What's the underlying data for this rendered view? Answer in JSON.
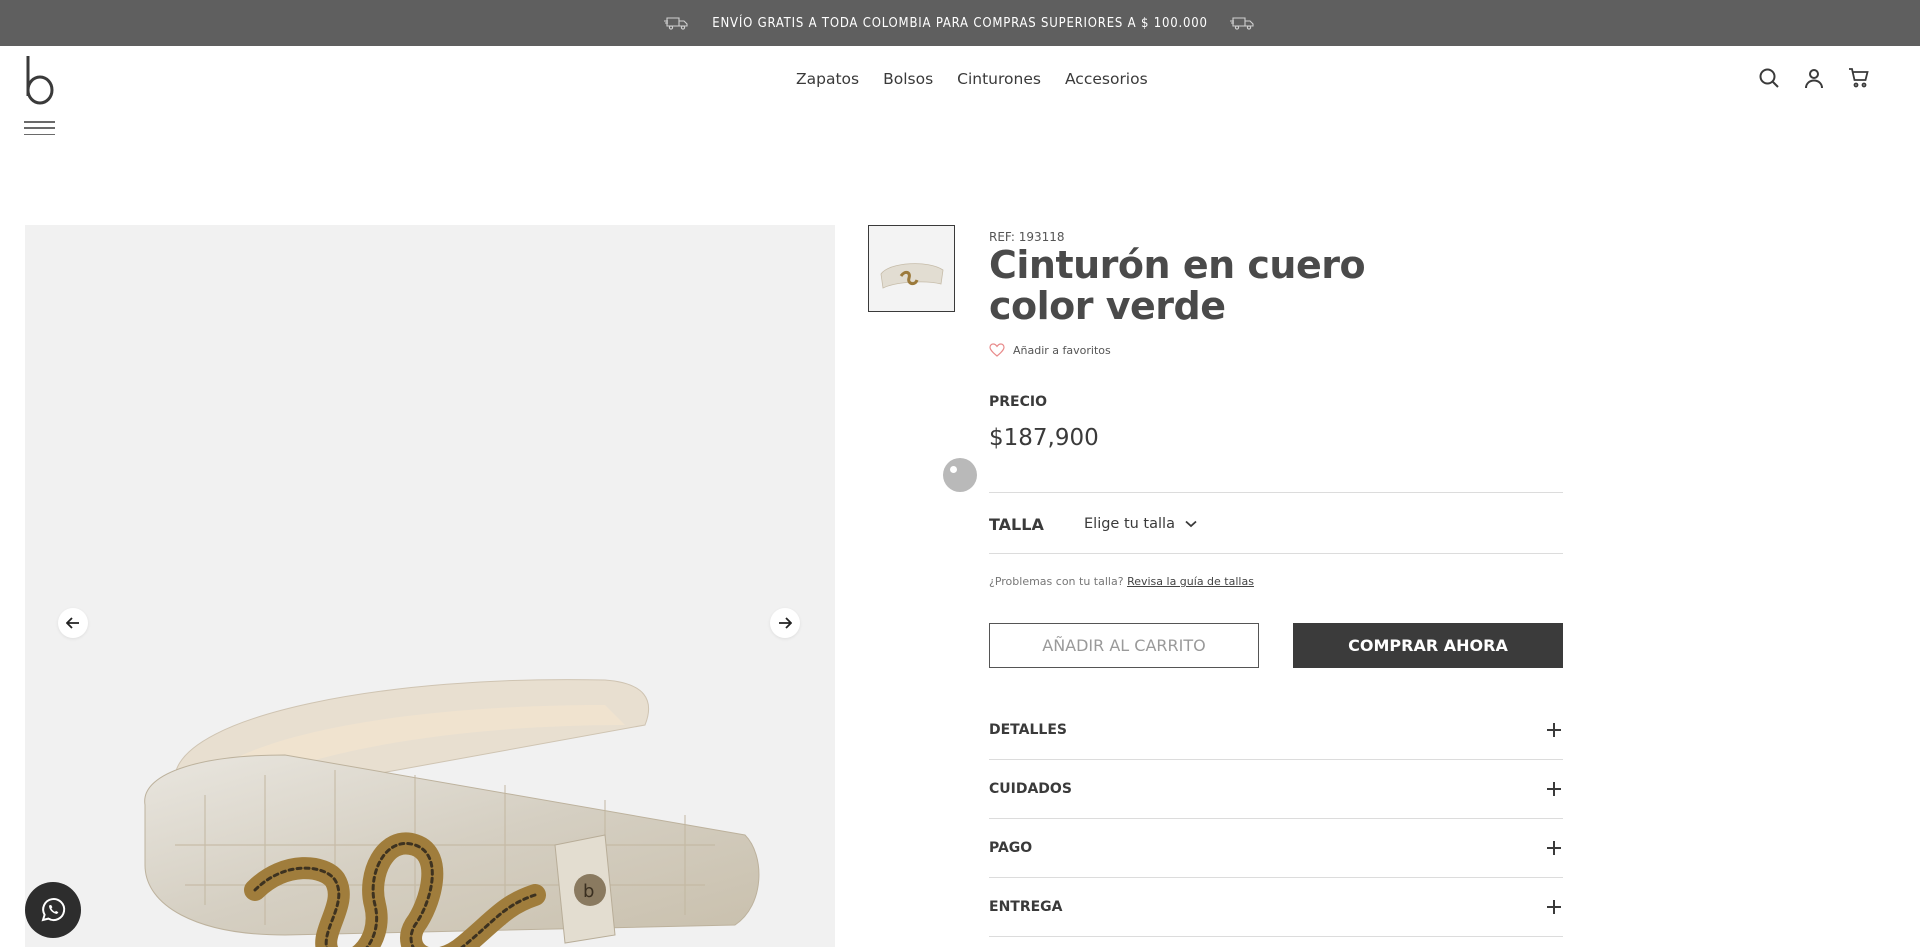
{
  "announcement": {
    "text": "ENVÍO GRATIS A TODA COLOMBIA PARA COMPRAS SUPERIORES A $ 100.000",
    "icon_left": "truck-icon",
    "icon_right": "truck-icon"
  },
  "header": {
    "logo_icon": "brand-b-logo",
    "menu_icon": "hamburger-icon",
    "nav": [
      {
        "label": "Zapatos"
      },
      {
        "label": "Bolsos"
      },
      {
        "label": "Cinturones"
      },
      {
        "label": "Accesorios"
      }
    ],
    "icons": [
      "search-icon",
      "user-icon",
      "cart-icon"
    ]
  },
  "gallery": {
    "prev_icon": "arrow-left-icon",
    "next_icon": "arrow-right-icon",
    "whatsapp_icon": "whatsapp-icon"
  },
  "product": {
    "ref": "REF: 193118",
    "title": "Cinturón en cuero color verde",
    "favorite_label": "Añadir a favoritos",
    "price_label": "PRECIO",
    "price": "$187,900",
    "size_label": "TALLA",
    "size_placeholder": "Elige tu talla",
    "size_help_text": "¿Problemas con tu talla?",
    "size_guide_link": "Revisa la guía de tallas",
    "add_to_cart": "AÑADIR AL CARRITO",
    "buy_now": "COMPRAR AHORA"
  },
  "accordion": [
    {
      "label": "DETALLES"
    },
    {
      "label": "CUIDADOS"
    },
    {
      "label": "PAGO"
    },
    {
      "label": "ENTREGA"
    }
  ],
  "colors": {
    "topbar": "#5f5f5f",
    "primary_button": "#3b3b3b",
    "heart": "#e88a8a"
  }
}
